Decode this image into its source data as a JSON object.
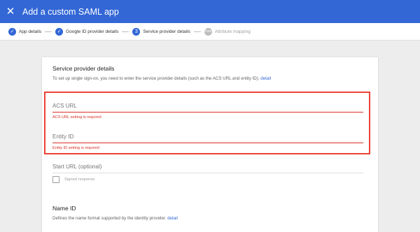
{
  "header": {
    "close_icon": "close-icon",
    "title": "Add a custom SAML app"
  },
  "stepper": {
    "steps": [
      {
        "marker": "✓",
        "label": "App details"
      },
      {
        "marker": "✓",
        "label": "Google ID provider details"
      },
      {
        "marker": "3",
        "label": "Service provider details"
      },
      {
        "marker": "Four",
        "label": "Attribute mapping"
      }
    ]
  },
  "section": {
    "title": "Service provider details",
    "description": "To set up single sign-on, you need to enter the service provider details (such as the ACS URL and entity ID).",
    "detail_link": "detail"
  },
  "fields": {
    "acs_url": {
      "placeholder": "ACS URL",
      "error": "ACS URL setting is required"
    },
    "entity_id": {
      "placeholder": "Entity ID",
      "error": "Entity ID setting is required"
    },
    "start_url": {
      "placeholder": "Start URL (optional)"
    }
  },
  "signed_response": {
    "label": "Signed response"
  },
  "name_id": {
    "title": "Name ID",
    "description": "Defines the name format supported by the identity provider.",
    "detail_link": "detail"
  },
  "colors": {
    "accent": "#3367d6",
    "error": "#d93025",
    "highlight": "#ea4335"
  }
}
